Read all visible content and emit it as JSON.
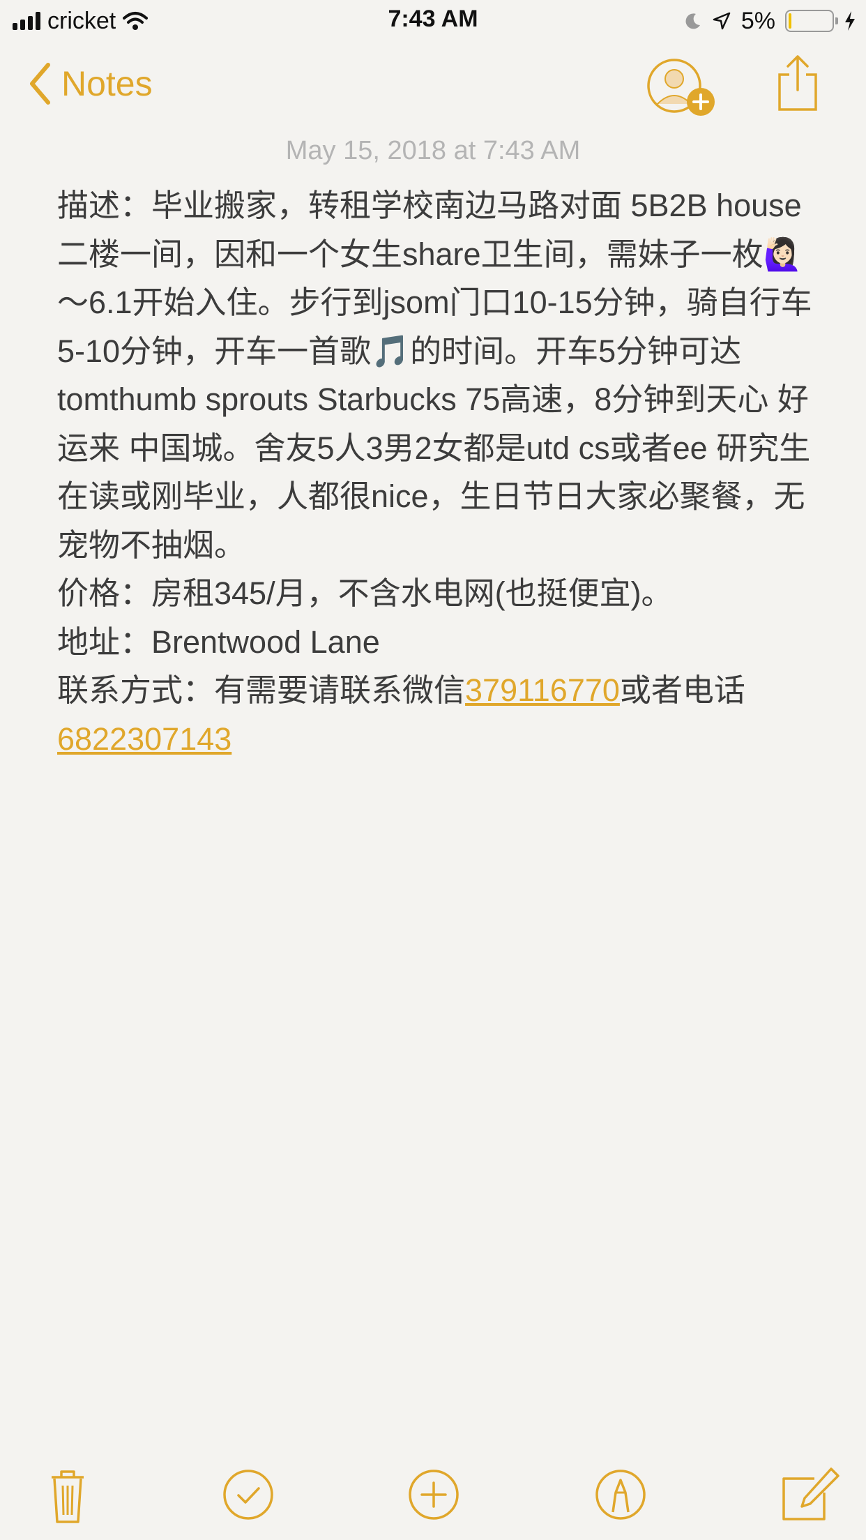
{
  "status_bar": {
    "carrier": "cricket",
    "time": "7:43 AM",
    "battery_percent": "5%",
    "battery_level": 0.05,
    "icons": [
      "signal-bars-icon",
      "wifi-icon",
      "moon-icon",
      "location-arrow-icon",
      "battery-icon",
      "charging-bolt-icon"
    ]
  },
  "nav": {
    "back_label": "Notes",
    "icons": [
      "chevron-left-icon",
      "add-person-icon",
      "share-icon"
    ]
  },
  "note": {
    "timestamp": "May 15, 2018 at 7:43 AM",
    "p1": "描述：毕业搬家，转租学校南边马路对面 5B2B house二楼一间，因和一个女生share卫生间，需妹子一枚🙋🏻‍♀️ ～6.1开始入住。步行到jsom门口10-15分钟，骑自行车5-10分钟，开车一首歌🎵的时间。开车5分钟可达tomthumb sprouts Starbucks 75高速，8分钟到天心 好运来 中国城。舍友5人3男2女都是utd cs或者ee 研究生在读或刚毕业，人都很nice，生日节日大家必聚餐，无宠物不抽烟。",
    "p2": "价格：房租345/月，不含水电网(也挺便宜)。",
    "p3": "地址：Brentwood Lane",
    "p4_prefix": "联系方式：有需要请联系微信",
    "wechat": "379116770",
    "p4_middle": "或者电话",
    "phone": "6822307143"
  },
  "toolbar": {
    "icons": [
      "trash-icon",
      "checklist-icon",
      "add-icon",
      "markup-icon",
      "compose-icon"
    ]
  },
  "colors": {
    "accent": "#e0a72b",
    "text": "#3c3c3c",
    "timestamp": "#b4b4b4",
    "background": "#f4f3f0"
  }
}
